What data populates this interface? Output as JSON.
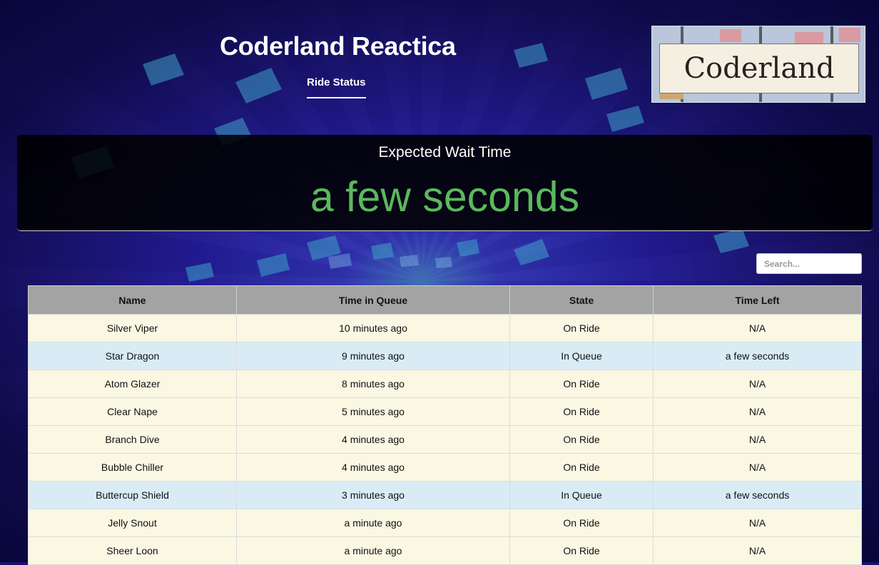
{
  "header": {
    "title": "Coderland Reactica",
    "nav_tab": "Ride Status",
    "logo_text": "Coderland"
  },
  "wait": {
    "label": "Expected Wait Time",
    "value": "a few seconds"
  },
  "search": {
    "placeholder": "Search..."
  },
  "table": {
    "columns": [
      "Name",
      "Time in Queue",
      "State",
      "Time Left"
    ],
    "rows": [
      {
        "name": "Silver Viper",
        "time_in_queue": "10 minutes ago",
        "state": "On Ride",
        "time_left": "N/A"
      },
      {
        "name": "Star Dragon",
        "time_in_queue": "9 minutes ago",
        "state": "In Queue",
        "time_left": "a few seconds"
      },
      {
        "name": "Atom Glazer",
        "time_in_queue": "8 minutes ago",
        "state": "On Ride",
        "time_left": "N/A"
      },
      {
        "name": "Clear Nape",
        "time_in_queue": "5 minutes ago",
        "state": "On Ride",
        "time_left": "N/A"
      },
      {
        "name": "Branch Dive",
        "time_in_queue": "4 minutes ago",
        "state": "On Ride",
        "time_left": "N/A"
      },
      {
        "name": "Bubble Chiller",
        "time_in_queue": "4 minutes ago",
        "state": "On Ride",
        "time_left": "N/A"
      },
      {
        "name": "Buttercup Shield",
        "time_in_queue": "3 minutes ago",
        "state": "In Queue",
        "time_left": "a few seconds"
      },
      {
        "name": "Jelly Snout",
        "time_in_queue": "a minute ago",
        "state": "On Ride",
        "time_left": "N/A"
      },
      {
        "name": "Sheer Loon",
        "time_in_queue": "a minute ago",
        "state": "On Ride",
        "time_left": "N/A"
      }
    ]
  },
  "colors": {
    "wait_value": "#5cb85c",
    "on_ride_row": "#faf7e3",
    "in_queue_row": "#d9ecf6",
    "header_row": "#a3a3a3"
  }
}
